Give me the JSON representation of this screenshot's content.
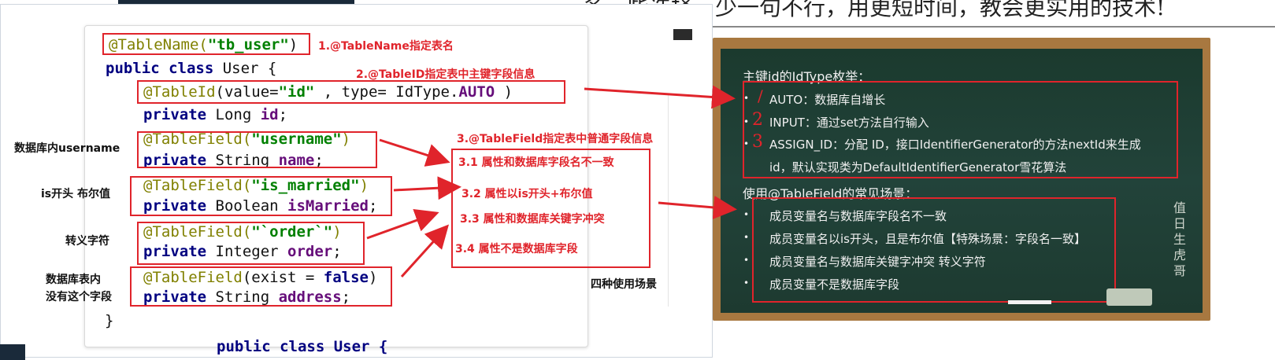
{
  "header": {
    "banner_text": "多一些选择，少一句不行，用更短时间，教会更实用的技术!"
  },
  "code": {
    "line1": {
      "ann": "@TableName(",
      "str": "\"tb_user\"",
      "end": ")"
    },
    "line2": {
      "kw": "public class",
      "rest": " User {"
    },
    "line3": {
      "ann": "@TableId",
      "mid1": "(value=",
      "str": "\"id\"",
      "mid2": " , type= IdType.",
      "fld": "AUTO",
      "end": " )"
    },
    "line4": {
      "kw": "private",
      "type": " Long ",
      "fld": "id",
      "end": ";"
    },
    "line5": {
      "ann": "@TableField(",
      "str": "\"username\"",
      "end": ")"
    },
    "line6": {
      "kw": "private",
      "type": " String ",
      "fld": "name",
      "end": ";"
    },
    "line7": {
      "ann": "@TableField(",
      "str": "\"is_married\"",
      "end": ")"
    },
    "line8": {
      "kw": "private",
      "type": " Boolean ",
      "fld": "isMarried",
      "end": ";"
    },
    "line9": {
      "ann": "@TableField(",
      "str": "\"`order`\"",
      "end": ")"
    },
    "line10": {
      "kw": "private",
      "type": " Integer ",
      "fld": "order",
      "end": ";"
    },
    "line11": {
      "ann": "@TableField",
      "mid": "(exist = ",
      "kw": "false",
      "end": ")"
    },
    "line12": {
      "kw": "private",
      "type": " String ",
      "fld": "address",
      "end": ";"
    },
    "line13": "}",
    "bottom_fragment": "public class User {"
  },
  "annotations": {
    "a1": "1.@TableName指定表名",
    "a2": "2.@TableID指定表中主键字段信息",
    "a3": "3.@TableField指定表中普通字段信息",
    "a31": "3.1 属性和数据库字段名不一致",
    "a32": "3.2 属性以is开头+布尔值",
    "a33": "3.3 属性和数据库关键字冲突",
    "a34": "3.4 属性不是数据库字段"
  },
  "side_labels": {
    "s1": "数据库内username",
    "s2": "is开头 布尔值",
    "s3": "转义字符",
    "s4a": "数据库表内",
    "s4b": "没有这个字段",
    "s5": "四种使用场景"
  },
  "board": {
    "heading1": "主键id的IdType枚举：",
    "items1": [
      "AUTO：数据库自增长",
      "INPUT：通过set方法自行输入",
      "ASSIGN_ID：分配 ID，接口IdentifierGenerator的方法nextId来生成",
      "id，默认实现类为DefaultIdentifierGenerator雪花算法"
    ],
    "heading2": "使用@TableField的常见场景：",
    "items2": [
      "成员变量名与数据库字段名不一致",
      "成员变量名以is开头，且是布尔值【特殊场景：字段名一致】",
      "成员变量名与数据库关键字冲突  转义字符",
      "成员变量不是数据库字段"
    ],
    "vertical_label": "值日生虎哥",
    "handwritten_marks": [
      "/",
      "2",
      "3"
    ]
  },
  "colors": {
    "red": "#e0242b",
    "board": "#1f3a30",
    "frame": "#a87840"
  }
}
